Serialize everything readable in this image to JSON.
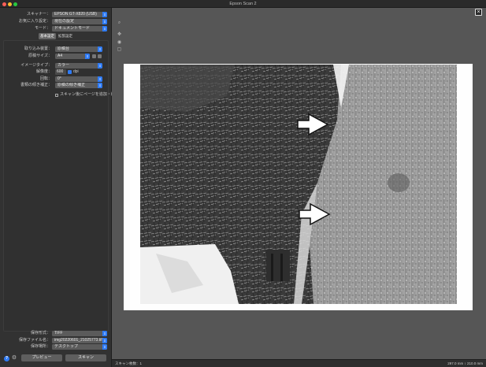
{
  "window": {
    "title": "Epson Scan 2"
  },
  "settings": {
    "scanner_label": "スキャナー：",
    "scanner_value": "EPSON GT-X820 (USB)",
    "favorite_label": "お気に入り設定：",
    "favorite_value": "現在の設定",
    "mode_label": "モード：",
    "mode_value": "ドキュメントモード"
  },
  "tabs": [
    {
      "label": "基本設定"
    },
    {
      "label": "拡張設定"
    }
  ],
  "basic": {
    "source_label": "取り込み装置：",
    "source_value": "原稿台",
    "size_label": "原稿サイズ：",
    "size_value": "A4",
    "image_type_label": "イメージタイプ：",
    "image_type_value": "カラー",
    "resolution_label": "解像度：",
    "resolution_value": "600",
    "resolution_unit": "dpi",
    "rotate_label": "回転：",
    "rotate_value": "0°",
    "skew_label": "書類の傾き補正：",
    "skew_value": "原稿の傾き補正",
    "add_pages_label": "スキャン後にページを追加・編集"
  },
  "save": {
    "format_label": "保存形式：",
    "format_value": "TIFF",
    "filename_label": "保存ファイル名：",
    "filename_value": "img20220601_21025773.tif",
    "folder_label": "保存場所：",
    "folder_value": "デスクトップ"
  },
  "buttons": {
    "preview": "プレビュー",
    "scan": "スキャン",
    "help": "?"
  },
  "status": {
    "scan_count": "スキャン枚数：1",
    "width": "297.0 mm",
    "height": "210.0 mm"
  },
  "colors": {
    "accent": "#2f7bf5"
  }
}
